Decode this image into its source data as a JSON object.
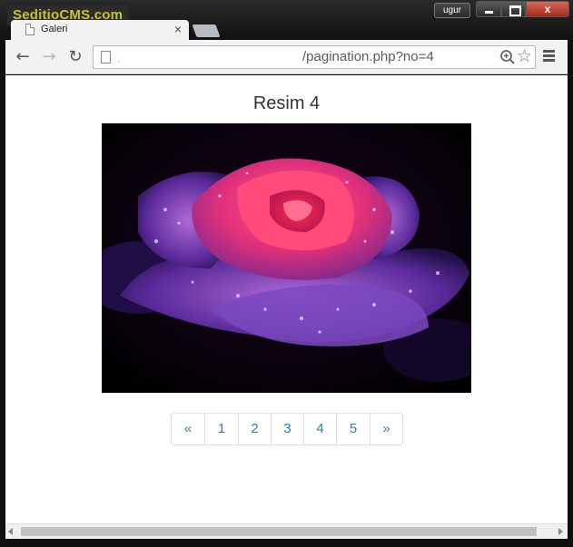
{
  "watermark": "SeditioCMS.com",
  "tab": {
    "title": "Galeri",
    "close": "×"
  },
  "window": {
    "user": "ugur",
    "close_glyph": "x"
  },
  "toolbar": {
    "back_glyph": "←",
    "forward_glyph": "→",
    "reload_glyph": "↻",
    "url_prefix": ".",
    "url": "/pagination.php?no=4",
    "star_glyph": "☆"
  },
  "page": {
    "heading": "Resim 4",
    "image_subject": "pink rose with water droplets on black background",
    "pagination": [
      "«",
      "1",
      "2",
      "3",
      "4",
      "5",
      "»"
    ],
    "pagination_widths": [
      36,
      37,
      36,
      36,
      36,
      37,
      36
    ]
  },
  "colors": {
    "watermark": "#c7c42e",
    "link": "#337ab7",
    "close_button": "#c0392b"
  }
}
